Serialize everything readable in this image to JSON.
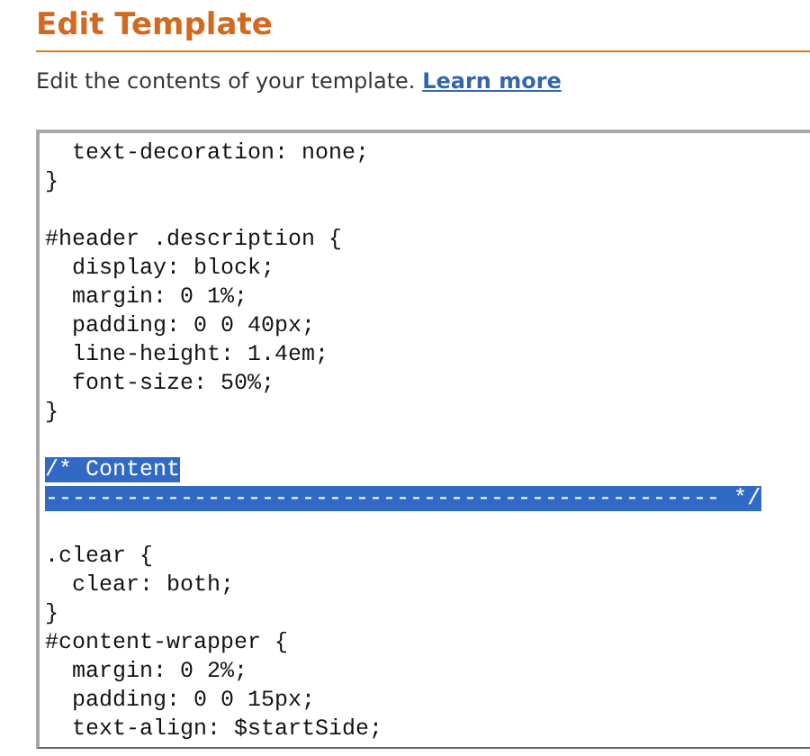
{
  "title": "Edit Template",
  "description": {
    "text": "Edit the contents of your template.",
    "link": "Learn more"
  },
  "editor": {
    "lines": [
      {
        "kind": "code",
        "text": "  text-decoration: none;"
      },
      {
        "kind": "code",
        "text": "}"
      },
      {
        "kind": "blank"
      },
      {
        "kind": "code",
        "text": "#header .description {"
      },
      {
        "kind": "code",
        "text": "  display: block;"
      },
      {
        "kind": "code",
        "text": "  margin: 0 1%;"
      },
      {
        "kind": "code",
        "text": "  padding: 0 0 40px;"
      },
      {
        "kind": "code",
        "text": "  line-height: 1.4em;"
      },
      {
        "kind": "code",
        "text": "  font-size: 50%;"
      },
      {
        "kind": "code",
        "text": "}"
      },
      {
        "kind": "blank"
      },
      {
        "kind": "code",
        "text": "/* Content",
        "highlighted": true
      },
      {
        "kind": "code",
        "text": "-------------------------------------------------- */",
        "highlighted": true
      },
      {
        "kind": "blank"
      },
      {
        "kind": "code",
        "text": ".clear {"
      },
      {
        "kind": "code",
        "text": "  clear: both;"
      },
      {
        "kind": "code",
        "text": "}"
      },
      {
        "kind": "code",
        "text": "#content-wrapper {"
      },
      {
        "kind": "code",
        "text": "  margin: 0 2%;"
      },
      {
        "kind": "code",
        "text": "  padding: 0 0 15px;"
      },
      {
        "kind": "code",
        "text": "  text-align: $startSide;"
      }
    ]
  }
}
